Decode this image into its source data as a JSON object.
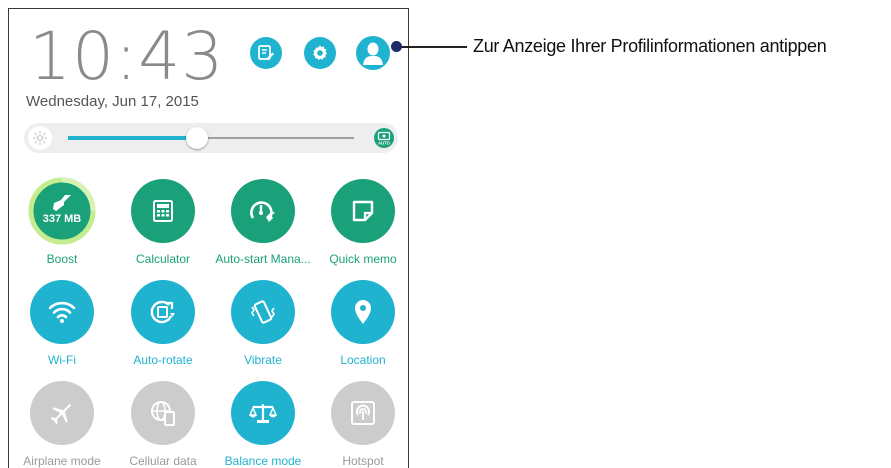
{
  "status": {
    "time": "10:43",
    "date": "Wednesday, Jun 17, 2015"
  },
  "header_buttons": [
    {
      "icon": "edit-icon",
      "color": "#1fb3d0"
    },
    {
      "icon": "settings-icon",
      "color": "#1fb3d0"
    },
    {
      "icon": "profile-icon",
      "color": "#1fb3d0"
    }
  ],
  "brightness": {
    "level": 0.45,
    "mode_label": "AUTO"
  },
  "tiles": [
    {
      "label": "Boost",
      "value_text": "337 MB",
      "icon": "broom-icon",
      "color": "#1aa179",
      "label_color": "#1aa179",
      "active": true
    },
    {
      "label": "Calculator",
      "icon": "calculator-icon",
      "color": "#1aa179",
      "label_color": "#1aa179",
      "active": true
    },
    {
      "label": "Auto-start Mana...",
      "icon": "speedometer-wrench-icon",
      "color": "#1aa179",
      "label_color": "#1aa179",
      "active": true
    },
    {
      "label": "Quick memo",
      "icon": "memo-icon",
      "color": "#1aa179",
      "label_color": "#1aa179",
      "active": true
    },
    {
      "label": "Wi-Fi",
      "icon": "wifi-icon",
      "color": "#1fb3d0",
      "label_color": "#1fb3d0",
      "active": true
    },
    {
      "label": "Auto-rotate",
      "icon": "rotate-icon",
      "color": "#1fb3d0",
      "label_color": "#1fb3d0",
      "active": true
    },
    {
      "label": "Vibrate",
      "icon": "vibrate-icon",
      "color": "#1fb3d0",
      "label_color": "#1fb3d0",
      "active": true
    },
    {
      "label": "Location",
      "icon": "location-pin-icon",
      "color": "#1fb3d0",
      "label_color": "#1fb3d0",
      "active": true
    },
    {
      "label": "Airplane mode",
      "icon": "airplane-icon",
      "color": "#cccccc",
      "label_color": "#9a9a9a",
      "active": false
    },
    {
      "label": "Cellular data",
      "icon": "globe-phone-icon",
      "color": "#cccccc",
      "label_color": "#9a9a9a",
      "active": false
    },
    {
      "label": "Balance mode",
      "icon": "balance-scale-icon",
      "color": "#1fb3d0",
      "label_color": "#1fb3d0",
      "active": true
    },
    {
      "label": "Hotspot",
      "icon": "hotspot-icon",
      "color": "#cccccc",
      "label_color": "#9a9a9a",
      "active": false
    }
  ],
  "callout": {
    "text": "Zur Anzeige Ihrer Profilinformationen antippen"
  }
}
